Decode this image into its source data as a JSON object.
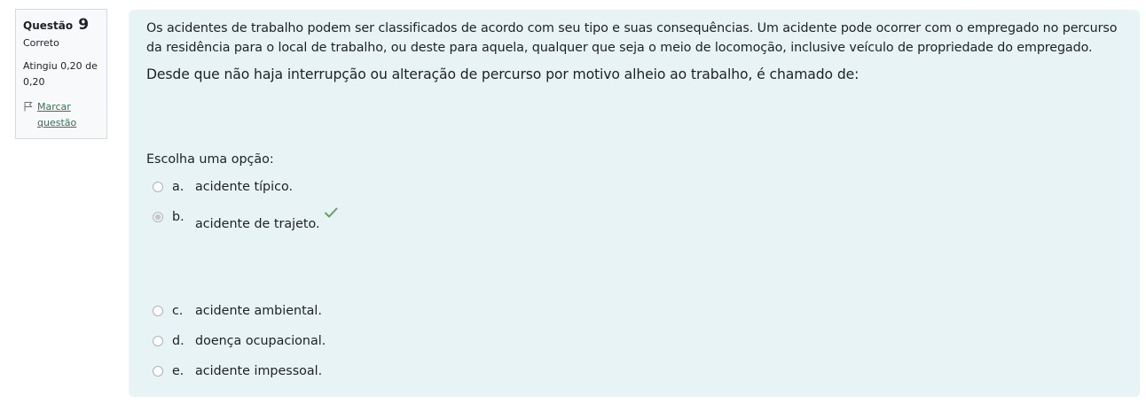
{
  "info": {
    "question_label": "Questão",
    "question_number": "9",
    "state": "Correto",
    "grade": "Atingiu 0,20 de 0,20",
    "flag_label": "Marcar questão"
  },
  "question": {
    "text": "Os acidentes de trabalho podem ser classificados de acordo com seu tipo e suas consequências. Um acidente pode ocorrer com o empregado no percurso da residência para o local de trabalho, ou deste para aquela, qualquer que seja o meio de locomoção, inclusive veículo de propriedade do empregado.",
    "text2": "Desde que não haja interrupção ou alteração de percurso por motivo alheio ao trabalho, é chamado de:",
    "prompt": "Escolha uma opção:"
  },
  "options": [
    {
      "letter": "a.",
      "text": "acidente típico.",
      "selected": false
    },
    {
      "letter": "b.",
      "text": "acidente de trajeto.",
      "selected": true,
      "correct": true
    },
    {
      "letter": "c.",
      "text": "acidente ambiental.",
      "selected": false
    },
    {
      "letter": "d.",
      "text": "doença ocupacional.",
      "selected": false
    },
    {
      "letter": "e.",
      "text": "acidente impessoal.",
      "selected": false
    }
  ],
  "icons": {
    "flag": "flag-icon",
    "correct": "check-icon"
  },
  "colors": {
    "panel_bg": "#e7f3f5",
    "link": "#3d6e54",
    "correct": "#5fa35f"
  }
}
